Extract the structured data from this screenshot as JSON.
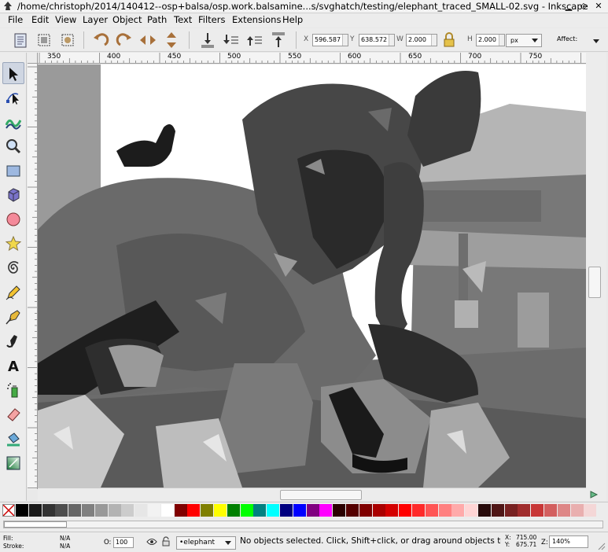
{
  "window": {
    "title": "/home/christoph/2014/140412--osp+balsa/osp.work.balsamine...s/svghatch/testing/elephant_traced_SMALL-02.svg - Inkscape",
    "controls": [
      "minimize",
      "maximize",
      "close"
    ]
  },
  "menu": [
    {
      "label": "File",
      "key": "F"
    },
    {
      "label": "Edit",
      "key": "E"
    },
    {
      "label": "View",
      "key": "V"
    },
    {
      "label": "Layer",
      "key": "L"
    },
    {
      "label": "Object",
      "key": "O"
    },
    {
      "label": "Path",
      "key": "P"
    },
    {
      "label": "Text",
      "key": "T"
    },
    {
      "label": "Filters",
      "key": "s"
    },
    {
      "label": "Extensions",
      "key": "x"
    },
    {
      "label": "Help",
      "key": "H"
    }
  ],
  "toolbar": {
    "x_label": "X",
    "x_value": "596.587",
    "y_label": "Y",
    "y_value": "638.572",
    "w_label": "W",
    "w_value": "2.000",
    "h_label": "H",
    "h_value": "2.000",
    "unit": "px",
    "affect_label": "Affect:"
  },
  "ruler": {
    "labels": [
      "350",
      "400",
      "450",
      "500",
      "550",
      "600",
      "650",
      "700",
      "750"
    ]
  },
  "tools": [
    "selector-tool",
    "node-tool",
    "tweak-tool",
    "zoom-tool",
    "rectangle-tool",
    "3dbox-tool",
    "ellipse-tool",
    "star-tool",
    "spiral-tool",
    "pencil-tool",
    "pen-tool",
    "calligraphy-tool",
    "text-tool",
    "spray-tool",
    "eraser-tool",
    "paint-bucket-tool",
    "gradient-tool"
  ],
  "palette": {
    "colors": [
      "#000000",
      "#1a1a1a",
      "#333333",
      "#4d4d4d",
      "#666666",
      "#808080",
      "#999999",
      "#b3b3b3",
      "#cccccc",
      "#e6e6e6",
      "#f2f2f2",
      "#ffffff",
      "#800000",
      "#ff0000",
      "#808000",
      "#ffff00",
      "#008000",
      "#00ff00",
      "#008080",
      "#00ffff",
      "#000080",
      "#0000ff",
      "#800080",
      "#ff00ff",
      "#2b0000",
      "#550000",
      "#800000",
      "#aa0000",
      "#d40000",
      "#ff0000",
      "#ff2a2a",
      "#ff5555",
      "#ff8080",
      "#ffaaaa",
      "#ffd5d5",
      "#280b0b",
      "#501616",
      "#782121",
      "#a02c2c",
      "#c83737",
      "#d35f5f",
      "#de8787",
      "#e9afaf",
      "#f4d7d7"
    ]
  },
  "status": {
    "fill_label": "Fill:",
    "fill_value": "N/A",
    "stroke_label": "Stroke:",
    "stroke_value": "N/A",
    "opacity_label": "O:",
    "opacity_value": "100",
    "layer_name": "•elephant",
    "message": "No objects selected. Click, Shift+click, or drag around objects to sel",
    "cursor_x_label": "X:",
    "cursor_x": "715.00",
    "cursor_y_label": "Y:",
    "cursor_y": "675.71",
    "zoom_label": "Z:",
    "zoom_value": "140%"
  },
  "colors": {
    "chrome": "#ececec",
    "canvas_dark": "#3c3c3c",
    "canvas_mid": "#707070",
    "canvas_light": "#a8a8a8"
  }
}
